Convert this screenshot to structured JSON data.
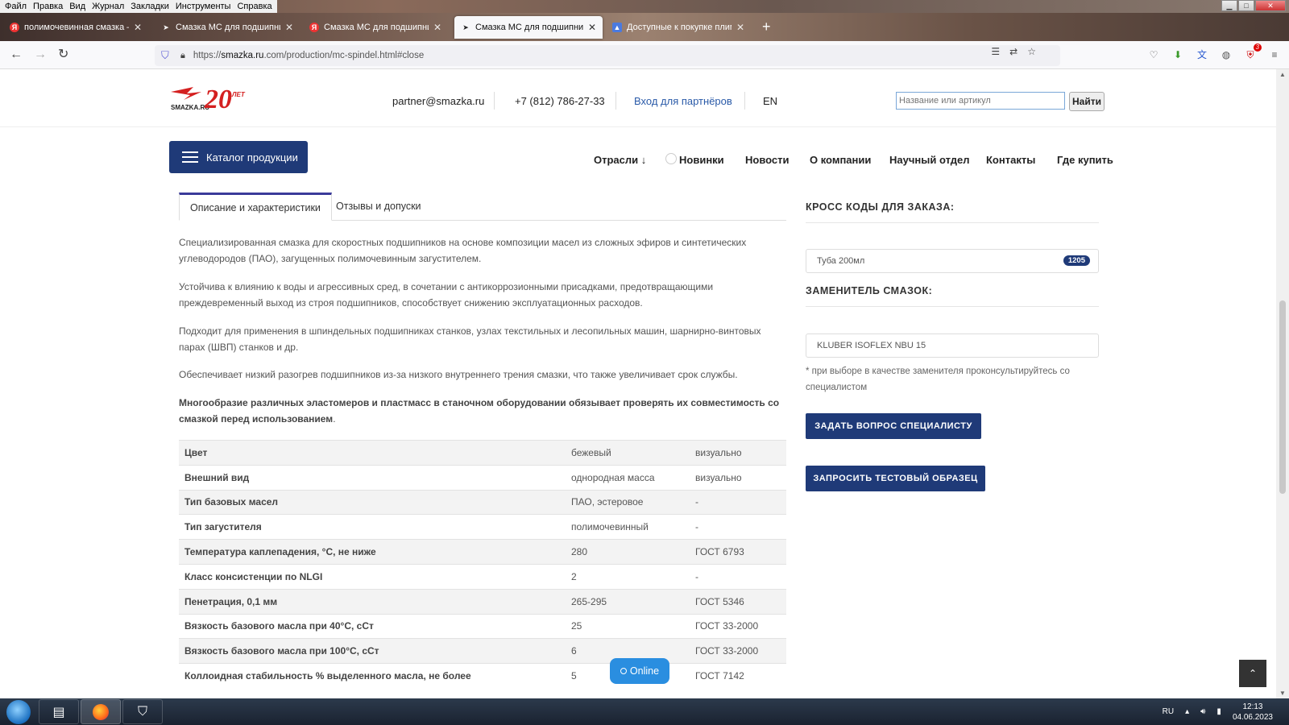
{
  "menu": [
    "Файл",
    "Правка",
    "Вид",
    "Журнал",
    "Закладки",
    "Инструменты",
    "Справка"
  ],
  "tabs": [
    {
      "title": "полимочевинная смазка — Ян...",
      "favicon": "yandex-icon"
    },
    {
      "title": "Смазка МС для подшипников",
      "favicon": "smazka-icon"
    },
    {
      "title": "Смазка МС для подшипников",
      "favicon": "yandex-icon"
    },
    {
      "title": "Смазка МС для подшипников",
      "favicon": "smazka-icon",
      "active": true
    },
    {
      "title": "Доступные к покупке плимоч...",
      "favicon": "drop-icon"
    }
  ],
  "url": {
    "prefix": "https://",
    "domain": "smazka.ru",
    "path": ".com/production/mc-spindel.html#close"
  },
  "header": {
    "email": "partner@smazka.ru",
    "phone": "+7 (812) 786-27-33",
    "partner_login": "Вход для партнёров",
    "lang": "EN",
    "search_placeholder": "Название или артикул",
    "search_button": "Найти",
    "logo_text": "SMAZKA.RU",
    "logo_years": "20",
    "logo_years_label": "ЛЕТ"
  },
  "nav": {
    "catalog": "Каталог продукции",
    "items": [
      "Отрасли ↓",
      "Новинки",
      "Новости",
      "О компании",
      "Научный отдел",
      "Контакты",
      "Где купить"
    ]
  },
  "product_tabs": [
    "Описание и характеристики",
    "Отзывы и допуски"
  ],
  "description": [
    "Специализированная смазка для скоростных подшипников на основе композиции масел из сложных эфиров и синтетических углеводородов (ПАО), загущенных полимочевинным загустителем.",
    "Устойчива к влиянию к воды и агрессивных сред, в сочетании с антикоррозионными присадками, предотвращающими преждевременный выход из строя подшипников, способствует снижению эксплуатационных расходов.",
    "Подходит для применения в шпиндельных подшипниках станков, узлах текстильных и лесопильных машин, шарнирно-винтовых парах (ШВП) станков и др.",
    "Обеспечивает низкий разогрев подшипников из-за низкого внутреннего трения смазки, что также увеличивает срок службы."
  ],
  "warning": "Многообразие различных эластомеров и пластмасс в станочном оборудовании обязывает проверять их совместимость со смазкой перед использованием",
  "warning_dot": ".",
  "properties": [
    [
      "Цвет",
      "бежевый",
      "визуально"
    ],
    [
      "Внешний вид",
      "однородная масса",
      "визуально"
    ],
    [
      "Тип базовых масел",
      "ПАО, эстеровое",
      "-"
    ],
    [
      "Тип загустителя",
      "полимочевинный",
      "-"
    ],
    [
      "Температура каплепадения, °С, не ниже",
      "280",
      "ГОСТ 6793"
    ],
    [
      "Класс консистенции по NLGI",
      "2",
      "-"
    ],
    [
      "Пенетрация, 0,1 мм",
      "265-295",
      "ГОСТ 5346"
    ],
    [
      "Вязкость базового масла при 40°С, сСт",
      "25",
      "ГОСТ 33-2000"
    ],
    [
      "Вязкость базового масла при 100°С, сСт",
      "6",
      "ГОСТ 33-2000"
    ],
    [
      "Коллоидная стабильность % выделенного масла, не более",
      "5",
      "ГОСТ 7142"
    ]
  ],
  "sidebar": {
    "cross_codes_title": "КРОСС КОДЫ ДЛЯ ЗАКАЗА:",
    "pack": "Туба 200мл",
    "pack_code": "1205",
    "replacement_title": "ЗАМЕНИТЕЛЬ СМАЗОК:",
    "replacement": "KLUBER ISOFLEX NBU 15",
    "note": "* при выборе в качестве заменителя проконсультируйтесь со специалистом",
    "ask_button": "ЗАДАТЬ ВОПРОС СПЕЦИАЛИСТУ",
    "sample_button": "ЗАПРОСИТЬ ТЕСТОВЫЙ ОБРАЗЕЦ"
  },
  "online_label": "Online",
  "taskbar": {
    "lang": "RU",
    "time": "12:13",
    "date": "04.06.2023"
  }
}
